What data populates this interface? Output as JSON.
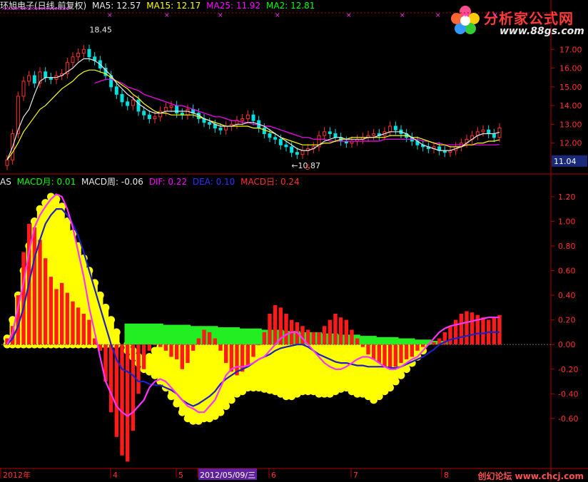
{
  "header": {
    "title": "环旭电子(日线,前复权)",
    "ma5": "MA5: 12.57",
    "ma15": "MA15: 12.17",
    "ma25": "MA25: 11.92",
    "ma2": "MA2: 12.81",
    "colors": {
      "title": "#e8e8e8",
      "ma5": "#e8e8e8",
      "ma15": "#ffff00",
      "ma25": "#ff00ff",
      "ma2": "#00ff00"
    }
  },
  "indicator_header": {
    "name": "AS",
    "macd_month": "MACD月: 0.01",
    "macd_week": "MACD周: -0.06",
    "dif": "DIF: 0.22",
    "dea": "DEA: 0.10",
    "macd_day": "MACD日: 0.24",
    "colors": {
      "name": "#e8e8e8",
      "macd_month": "#00ff00",
      "macd_week": "#e8e8e8",
      "dif": "#ff00ff",
      "dea": "#0000ff",
      "macd_day": "#ff3030"
    }
  },
  "price_panel": {
    "high_label": "18.45",
    "low_label": "10.87",
    "last_price": "11.04",
    "signal_mark": "S"
  },
  "logo": {
    "text": "分析家公式网",
    "url": "www.88gs.com"
  },
  "watermark": "创幻论坛 www.chcj.com",
  "x_axis": {
    "labels": [
      "2012年",
      "4",
      "5",
      "2012/05/09/三",
      "6",
      "7",
      "8"
    ],
    "highlight": "2012/05/09/三"
  },
  "chart_data": [
    {
      "type": "line",
      "name": "price",
      "y_ticks": [
        11.0,
        12.0,
        13.0,
        14.0,
        15.0,
        16.0,
        17.0
      ],
      "ylim": [
        10.5,
        18.8
      ],
      "grid": false,
      "close": [
        11.1,
        12.5,
        14.5,
        15.3,
        15.6,
        15.2,
        15.8,
        15.5,
        15.4,
        15.6,
        15.7,
        16.3,
        16.6,
        16.8,
        17.0,
        16.6,
        16.4,
        16.0,
        15.6,
        15.0,
        14.6,
        14.2,
        14.0,
        14.3,
        13.7,
        13.5,
        13.3,
        13.4,
        13.7,
        13.9,
        14.0,
        13.6,
        13.5,
        13.8,
        13.6,
        13.3,
        13.1,
        13.0,
        12.8,
        12.7,
        12.9,
        13.0,
        13.2,
        13.3,
        13.5,
        13.2,
        12.8,
        12.5,
        12.3,
        12.2,
        11.9,
        11.8,
        11.5,
        11.4,
        11.6,
        11.7,
        11.8,
        12.4,
        12.6,
        12.5,
        12.3,
        12.1,
        12.0,
        12.1,
        12.2,
        12.3,
        12.4,
        12.5,
        12.4,
        12.6,
        12.9,
        12.7,
        12.5,
        12.3,
        12.1,
        11.9,
        11.8,
        11.7,
        11.8,
        11.6,
        11.5,
        11.6,
        11.8,
        12.0,
        12.2,
        12.4,
        12.6,
        12.7,
        12.5,
        12.3,
        12.81
      ],
      "ma5": [
        11.1,
        11.8,
        12.7,
        13.4,
        13.8,
        14.6,
        15.3,
        15.5,
        15.5,
        15.5,
        15.6,
        15.8,
        16.0,
        16.3,
        16.5,
        16.5,
        16.4,
        16.2,
        15.9,
        15.6,
        15.2,
        14.9,
        14.6,
        14.4,
        14.1,
        13.9,
        13.7,
        13.6,
        13.6,
        13.7,
        13.7,
        13.7,
        13.7,
        13.7,
        13.6,
        13.5,
        13.3,
        13.2,
        13.0,
        12.9,
        12.9,
        12.9,
        13.0,
        13.0,
        13.1,
        13.1,
        13.0,
        12.9,
        12.7,
        12.5,
        12.3,
        12.1,
        11.9,
        11.7,
        11.6,
        11.6,
        11.7,
        11.9,
        12.1,
        12.2,
        12.3,
        12.3,
        12.2,
        12.2,
        12.2,
        12.2,
        12.3,
        12.3,
        12.4,
        12.5,
        12.6,
        12.6,
        12.6,
        12.5,
        12.3,
        12.1,
        11.9,
        11.8,
        11.7,
        11.6,
        11.6,
        11.6,
        11.7,
        11.8,
        12.0,
        12.2,
        12.4,
        12.5,
        12.5,
        12.5,
        12.57
      ],
      "ma15": [
        11.1,
        11.5,
        12.0,
        12.6,
        13.0,
        13.4,
        13.8,
        14.0,
        14.3,
        14.6,
        14.9,
        15.1,
        15.3,
        15.6,
        15.8,
        15.9,
        15.9,
        15.8,
        15.7,
        15.5,
        15.3,
        15.1,
        14.9,
        14.6,
        14.4,
        14.1,
        13.9,
        13.7,
        13.6,
        13.6,
        13.5,
        13.5,
        13.5,
        13.5,
        13.5,
        13.4,
        13.3,
        13.2,
        13.1,
        13.0,
        12.9,
        12.9,
        12.9,
        12.9,
        12.9,
        12.8,
        12.8,
        12.7,
        12.6,
        12.5,
        12.3,
        12.2,
        12.1,
        12.0,
        11.9,
        11.9,
        11.9,
        11.9,
        12.0,
        12.0,
        12.1,
        12.2,
        12.2,
        12.3,
        12.3,
        12.3,
        12.3,
        12.3,
        12.3,
        12.3,
        12.4,
        12.4,
        12.4,
        12.4,
        12.3,
        12.3,
        12.2,
        12.1,
        12.0,
        11.9,
        11.9,
        11.8,
        11.8,
        11.8,
        11.9,
        11.9,
        12.0,
        12.0,
        12.1,
        12.1,
        12.17
      ],
      "ma25": [
        null,
        null,
        null,
        null,
        null,
        null,
        null,
        null,
        null,
        null,
        null,
        null,
        null,
        null,
        null,
        null,
        15.2,
        15.3,
        15.4,
        15.4,
        15.3,
        15.2,
        15.0,
        14.9,
        14.8,
        14.6,
        14.5,
        14.4,
        14.3,
        14.2,
        14.1,
        14.0,
        14.0,
        13.9,
        13.8,
        13.7,
        13.6,
        13.5,
        13.4,
        13.4,
        13.3,
        13.2,
        13.2,
        13.1,
        13.1,
        13.0,
        13.0,
        12.9,
        12.9,
        12.8,
        12.7,
        12.6,
        12.5,
        12.4,
        12.3,
        12.3,
        12.2,
        12.2,
        12.2,
        12.1,
        12.1,
        12.1,
        12.1,
        12.1,
        12.1,
        12.1,
        12.1,
        12.1,
        12.1,
        12.2,
        12.2,
        12.2,
        12.2,
        12.2,
        12.2,
        12.2,
        12.1,
        12.1,
        12.0,
        12.0,
        11.9,
        11.9,
        11.9,
        11.9,
        11.9,
        11.9,
        11.9,
        11.9,
        11.9,
        11.9,
        11.92
      ]
    },
    {
      "type": "bar",
      "name": "macd",
      "y_ticks": [
        -0.6,
        -0.4,
        -0.2,
        0.0,
        0.2,
        0.4,
        0.6,
        0.8,
        1.0,
        1.2
      ],
      "ylim": [
        -1.0,
        1.28
      ],
      "grid": false,
      "macd_bars": [
        0.05,
        0.15,
        0.4,
        0.75,
        0.98,
        0.95,
        0.85,
        0.7,
        0.55,
        0.45,
        0.5,
        0.42,
        0.35,
        0.3,
        0.25,
        0.2,
        0.05,
        -0.05,
        -0.3,
        -0.55,
        -0.75,
        -0.9,
        -0.95,
        -0.7,
        -0.4,
        -0.2,
        -0.05,
        0.0,
        -0.02,
        -0.05,
        -0.1,
        -0.12,
        -0.2,
        -0.15,
        -0.05,
        0.05,
        0.12,
        0.1,
        0.05,
        -0.05,
        -0.15,
        -0.22,
        -0.25,
        -0.22,
        -0.18,
        -0.1,
        0.0,
        0.1,
        0.25,
        0.32,
        0.3,
        0.25,
        0.2,
        0.18,
        0.15,
        0.12,
        0.1,
        0.1,
        0.15,
        0.2,
        0.25,
        0.22,
        0.2,
        0.12,
        0.05,
        -0.02,
        -0.08,
        -0.12,
        -0.15,
        -0.18,
        -0.2,
        -0.18,
        -0.15,
        -0.12,
        -0.1,
        -0.05,
        -0.02,
        0.0,
        0.02,
        0.05,
        0.1,
        0.15,
        0.2,
        0.25,
        0.27,
        0.26,
        0.24,
        0.22,
        0.2,
        0.22,
        0.24
      ],
      "dif": [
        0.0,
        0.1,
        0.3,
        0.5,
        0.75,
        0.95,
        1.05,
        1.12,
        1.18,
        1.22,
        1.2,
        1.1,
        0.95,
        0.75,
        0.55,
        0.3,
        0.1,
        -0.1,
        -0.3,
        -0.4,
        -0.5,
        -0.55,
        -0.58,
        -0.55,
        -0.5,
        -0.45,
        -0.35,
        -0.3,
        -0.28,
        -0.3,
        -0.35,
        -0.4,
        -0.45,
        -0.5,
        -0.52,
        -0.55,
        -0.55,
        -0.5,
        -0.45,
        -0.35,
        -0.25,
        -0.2,
        -0.18,
        -0.18,
        -0.17,
        -0.15,
        -0.12,
        -0.1,
        -0.05,
        0.0,
        0.05,
        0.08,
        0.1,
        0.1,
        0.05,
        0.0,
        -0.05,
        -0.1,
        -0.15,
        -0.18,
        -0.2,
        -0.2,
        -0.18,
        -0.15,
        -0.12,
        -0.1,
        -0.1,
        -0.12,
        -0.15,
        -0.18,
        -0.2,
        -0.2,
        -0.18,
        -0.15,
        -0.12,
        -0.1,
        -0.05,
        0.0,
        0.05,
        0.1,
        0.13,
        0.15,
        0.16,
        0.17,
        0.18,
        0.19,
        0.2,
        0.21,
        0.22,
        0.22,
        0.22
      ],
      "dea": [
        0.0,
        0.05,
        0.15,
        0.3,
        0.5,
        0.7,
        0.85,
        0.98,
        1.05,
        1.1,
        1.1,
        1.05,
        0.98,
        0.88,
        0.75,
        0.6,
        0.45,
        0.3,
        0.15,
        0.0,
        -0.12,
        -0.2,
        -0.22,
        -0.25,
        -0.3,
        -0.3,
        -0.32,
        -0.33,
        -0.33,
        -0.35,
        -0.37,
        -0.4,
        -0.45,
        -0.48,
        -0.5,
        -0.48,
        -0.45,
        -0.42,
        -0.38,
        -0.32,
        -0.28,
        -0.25,
        -0.22,
        -0.2,
        -0.18,
        -0.15,
        -0.12,
        -0.1,
        -0.08,
        -0.05,
        -0.03,
        -0.02,
        -0.01,
        0.0,
        0.0,
        -0.02,
        -0.05,
        -0.08,
        -0.1,
        -0.12,
        -0.14,
        -0.15,
        -0.15,
        -0.16,
        -0.17,
        -0.17,
        -0.18,
        -0.18,
        -0.18,
        -0.18,
        -0.19,
        -0.19,
        -0.18,
        -0.16,
        -0.14,
        -0.12,
        -0.1,
        -0.07,
        -0.04,
        0.0,
        0.02,
        0.04,
        0.05,
        0.06,
        0.07,
        0.08,
        0.09,
        0.09,
        0.1,
        0.1,
        0.1
      ],
      "yellow_top": [
        0.05,
        0.2,
        0.4,
        0.6,
        0.8,
        1.0,
        1.1,
        1.15,
        1.2,
        1.18,
        1.12,
        1.0,
        0.9,
        0.8,
        0.7,
        0.6,
        0.5,
        0.4,
        0.3,
        0.2,
        0.1,
        0.0,
        0.0,
        -0.05,
        -0.1,
        -0.12,
        -0.1,
        -0.05,
        -0.02,
        0.0,
        0.0,
        0.0,
        0.0,
        0.0,
        0.0,
        0.0,
        0.0,
        0.0,
        0.0,
        0.0,
        0.0,
        0.0,
        0.0,
        0.0,
        0.0,
        0.0,
        0.0,
        0.0,
        0.0,
        0.0,
        0.0,
        0.0,
        0.0,
        0.0,
        0.0,
        0.0,
        0.0,
        0.0,
        0.0,
        0.0,
        0.0,
        0.0,
        0.0,
        0.0,
        0.0,
        0.0,
        0.0,
        0.0,
        0.0,
        0.0,
        0.0,
        0.0,
        0.0,
        0.0,
        0.0,
        0.0,
        0.0,
        0.0,
        0.0,
        0.0,
        0.0,
        0.0,
        0.0,
        0.0,
        0.0,
        0.0,
        0.0,
        0.0,
        0.0,
        0.0,
        0.0
      ],
      "yellow_bottom": [
        0.0,
        0.0,
        0.0,
        0.0,
        0.0,
        0.0,
        0.0,
        0.0,
        0.0,
        0.0,
        0.0,
        0.0,
        0.0,
        0.0,
        0.0,
        0.0,
        0.0,
        0.0,
        0.0,
        0.0,
        0.0,
        0.0,
        -0.05,
        -0.1,
        -0.15,
        -0.2,
        -0.22,
        -0.25,
        -0.3,
        -0.35,
        -0.42,
        -0.48,
        -0.55,
        -0.6,
        -0.62,
        -0.62,
        -0.6,
        -0.6,
        -0.58,
        -0.55,
        -0.5,
        -0.45,
        -0.4,
        -0.38,
        -0.35,
        -0.35,
        -0.35,
        -0.36,
        -0.37,
        -0.38,
        -0.4,
        -0.42,
        -0.42,
        -0.4,
        -0.38,
        -0.38,
        -0.38,
        -0.4,
        -0.4,
        -0.4,
        -0.38,
        -0.36,
        -0.35,
        -0.38,
        -0.4,
        -0.4,
        -0.42,
        -0.45,
        -0.42,
        -0.38,
        -0.35,
        -0.3,
        -0.25,
        -0.2,
        -0.15,
        -0.1,
        -0.05,
        0.0,
        0.0,
        0.0,
        0.0,
        0.0,
        0.0,
        0.0,
        0.0,
        0.0,
        0.0,
        0.0,
        0.0,
        0.0,
        0.0
      ],
      "green_top": [
        null,
        null,
        null,
        null,
        null,
        null,
        null,
        null,
        null,
        null,
        null,
        null,
        null,
        null,
        null,
        null,
        null,
        null,
        null,
        null,
        null,
        null,
        0.17,
        0.17,
        0.17,
        0.17,
        0.17,
        0.17,
        0.17,
        0.16,
        0.16,
        0.16,
        0.16,
        0.16,
        0.15,
        0.15,
        0.15,
        0.15,
        0.15,
        0.14,
        0.14,
        0.14,
        0.14,
        0.13,
        0.13,
        0.13,
        0.13,
        0.12,
        0.12,
        0.12,
        0.12,
        0.11,
        0.11,
        0.11,
        0.1,
        0.1,
        0.1,
        0.1,
        0.09,
        0.09,
        0.09,
        0.08,
        0.08,
        0.08,
        0.08,
        0.07,
        0.07,
        0.07,
        0.06,
        0.06,
        0.06,
        0.06,
        0.05,
        0.05,
        0.05,
        0.04,
        0.04,
        0.04,
        0.03,
        0.03,
        0.03,
        null,
        null,
        null,
        null,
        null,
        null,
        null,
        null,
        null,
        null
      ]
    }
  ]
}
